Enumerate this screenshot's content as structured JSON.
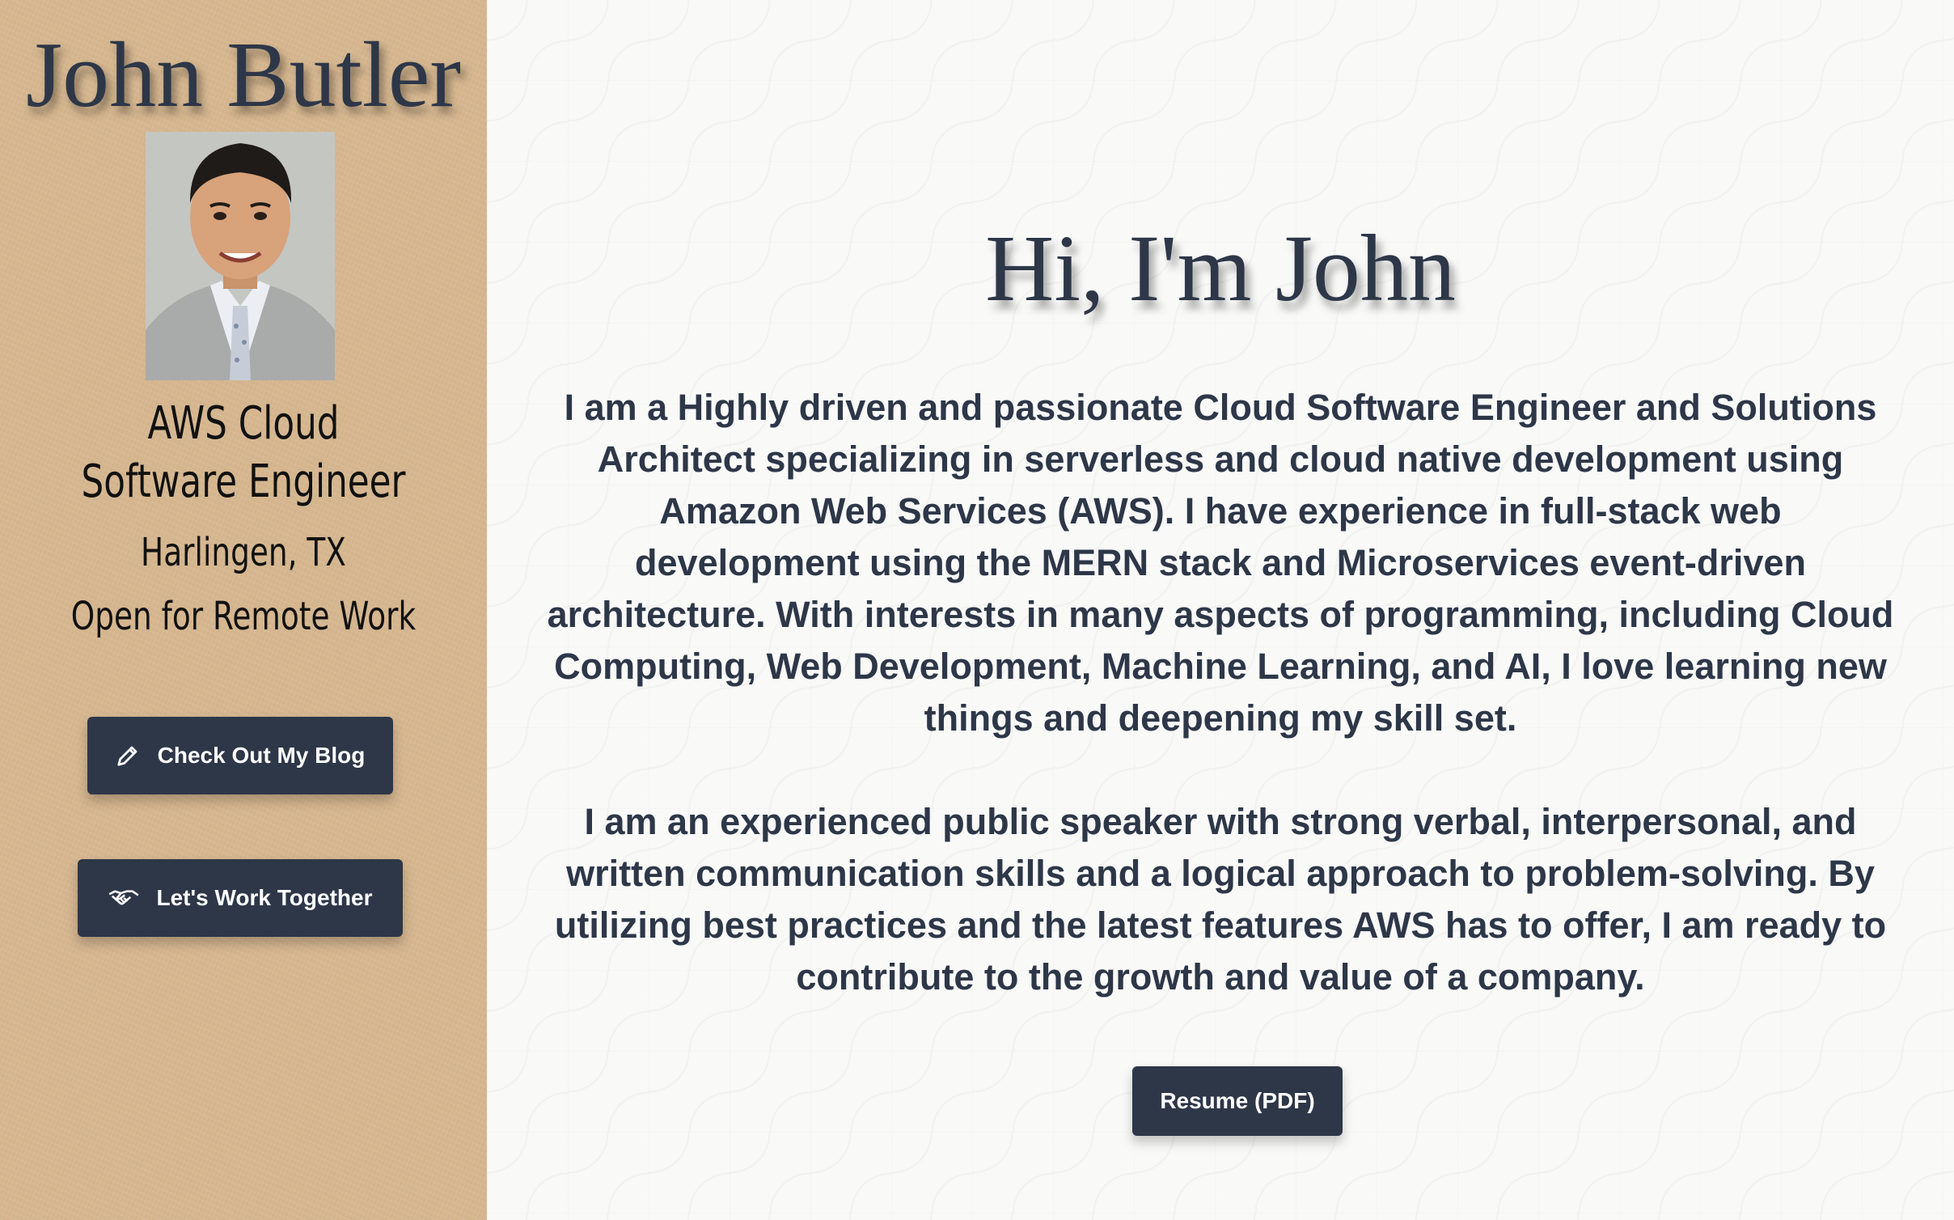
{
  "sidebar": {
    "name": "John Butler",
    "title": "AWS Cloud Software Engineer",
    "location": "Harlingen, TX",
    "availability": "Open for Remote Work",
    "buttons": [
      {
        "label": "Check Out My Blog",
        "icon": "pencil-icon"
      },
      {
        "label": "Let's Work Together",
        "icon": "handshake-icon"
      }
    ]
  },
  "main": {
    "greeting": "Hi, I'm John",
    "paragraphs": [
      "I am a Highly driven and passionate Cloud Software Engineer and Solutions Architect specializing in serverless and cloud native development using Amazon Web Services (AWS). I have experience in full-stack web development using the MERN stack and Microservices event-driven architecture. With interests in many aspects of programming, including Cloud Computing, Web Development, Machine Learning, and AI, I love learning new things and deepening my skill set.",
      "I am an experienced public speaker with strong verbal, interpersonal, and written communication skills and a logical approach to problem-solving. By utilizing best practices and the latest features AWS has to offer, I am ready to contribute to the growth and value of a company."
    ],
    "resume_button": "Resume (PDF)"
  },
  "colors": {
    "sidebar_bg": "#d5b68f",
    "button_bg": "#2d3748",
    "text_dark": "#2d3748",
    "main_bg": "#f9f9f8"
  }
}
